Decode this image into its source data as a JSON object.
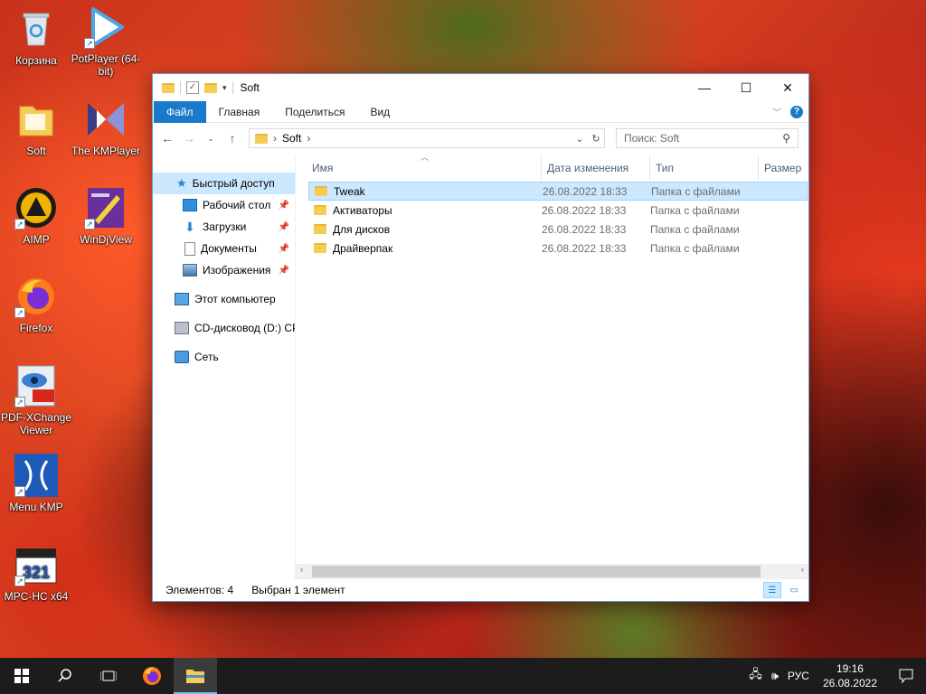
{
  "desktop": {
    "icons": [
      {
        "label": "Корзина"
      },
      {
        "label": "PotPlayer (64-bit)"
      },
      {
        "label": "Soft"
      },
      {
        "label": "The KMPlayer"
      },
      {
        "label": "AIMP"
      },
      {
        "label": "WinDjView"
      },
      {
        "label": "Firefox"
      },
      {
        "label": "PDF-XChange Viewer"
      },
      {
        "label": "Menu KMP"
      },
      {
        "label": "MPC-HC x64"
      }
    ]
  },
  "explorer": {
    "title": "Soft",
    "ribbon_tabs": {
      "file": "Файл",
      "home": "Главная",
      "share": "Поделиться",
      "view": "Вид"
    },
    "address": {
      "current": "Soft",
      "separator": "›"
    },
    "search_placeholder": "Поиск: Soft",
    "nav": {
      "quick_access": "Быстрый доступ",
      "desktop": "Рабочий стол",
      "downloads": "Загрузки",
      "documents": "Документы",
      "pictures": "Изображения",
      "this_pc": "Этот компьютер",
      "cd_drive": "CD-дисковод (D:) CP",
      "network": "Сеть"
    },
    "columns": {
      "name": "Имя",
      "date": "Дата изменения",
      "type": "Тип",
      "size": "Размер"
    },
    "files": [
      {
        "name": "Tweak",
        "date": "26.08.2022 18:33",
        "type": "Папка с файлами",
        "selected": true
      },
      {
        "name": "Активаторы",
        "date": "26.08.2022 18:33",
        "type": "Папка с файлами",
        "selected": false
      },
      {
        "name": "Для дисков",
        "date": "26.08.2022 18:33",
        "type": "Папка с файлами",
        "selected": false
      },
      {
        "name": "Драйверпак",
        "date": "26.08.2022 18:33",
        "type": "Папка с файлами",
        "selected": false
      }
    ],
    "status": {
      "count": "Элементов: 4",
      "selection": "Выбран 1 элемент"
    }
  },
  "taskbar": {
    "language": "РУС",
    "time": "19:16",
    "date": "26.08.2022"
  },
  "colors": {
    "accent": "#1979ca",
    "selection": "#cce8ff",
    "folder": "#f5cd55"
  }
}
